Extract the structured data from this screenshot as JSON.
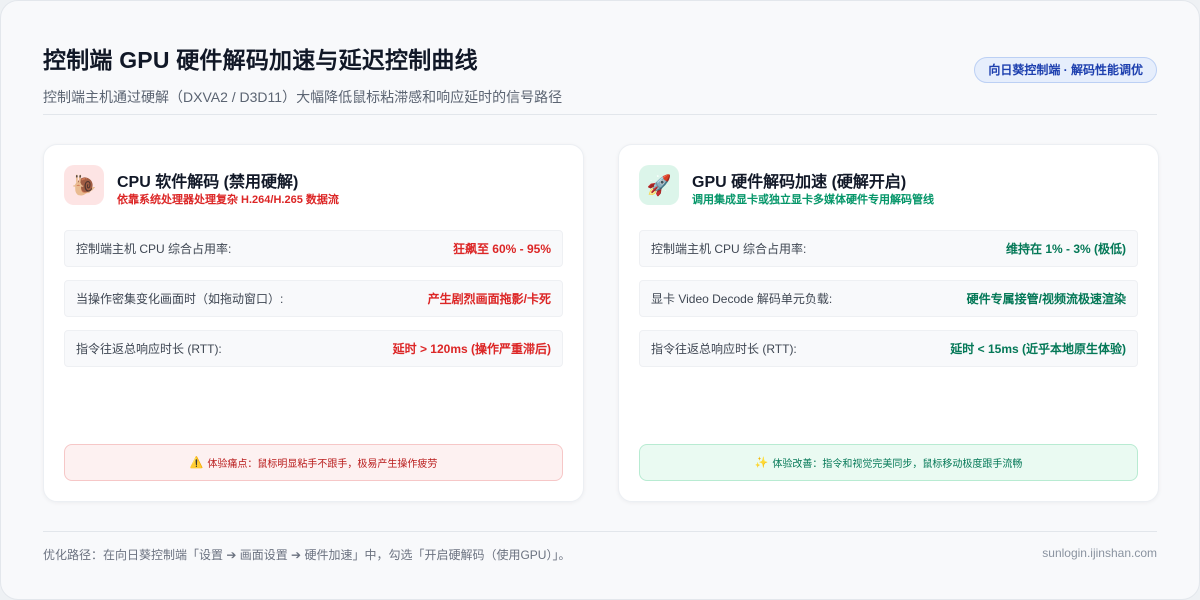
{
  "header": {
    "title": "控制端 GPU 硬件解码加速与延迟控制曲线",
    "subtitle": "控制端主机通过硬解（DXVA2 / D3D11）大幅降低鼠标粘滞感和响应延时的信号路径",
    "badge": "向日葵控制端 · 解码性能调优"
  },
  "cards": [
    {
      "icon": "snail-icon",
      "icon_glyph": "🐌",
      "title": "CPU 软件解码 (禁用硬解)",
      "desc": "依靠系统处理器处理复杂 H.264/H.265 数据流",
      "rows": [
        {
          "label": "控制端主机 CPU 综合占用率:",
          "value": "狂飙至 60% - 95%"
        },
        {
          "label": "当操作密集变化画面时（如拖动窗口）:",
          "value": "产生剧烈画面拖影/卡死"
        },
        {
          "label": "指令往返总响应时长 (RTT):",
          "value": "延时 > 120ms (操作严重滞后)"
        }
      ],
      "note_icon": "warning-icon",
      "note_glyph": "⚠️",
      "note": "体验痛点：鼠标明显粘手不跟手，极易产生操作疲劳"
    },
    {
      "icon": "rocket-icon",
      "icon_glyph": "🚀",
      "title": "GPU 硬件解码加速 (硬解开启)",
      "desc": "调用集成显卡或独立显卡多媒体硬件专用解码管线",
      "rows": [
        {
          "label": "控制端主机 CPU 综合占用率:",
          "value": "维持在 1% - 3% (极低)"
        },
        {
          "label": "显卡 Video Decode 解码单元负载:",
          "value": "硬件专属接管/视频流极速渲染"
        },
        {
          "label": "指令往返总响应时长 (RTT):",
          "value": "延时 < 15ms (近乎本地原生体验)"
        }
      ],
      "note_icon": "sparkles-icon",
      "note_glyph": "✨",
      "note": "体验改善：指令和视觉完美同步，鼠标移动极度跟手流畅"
    }
  ],
  "footer": {
    "text": "优化路径：在向日葵控制端「设置 ➔ 画面设置 ➔ 硬件加速」中，勾选「开启硬解码（使用GPU）」。",
    "url": "sunlogin.ijinshan.com"
  }
}
